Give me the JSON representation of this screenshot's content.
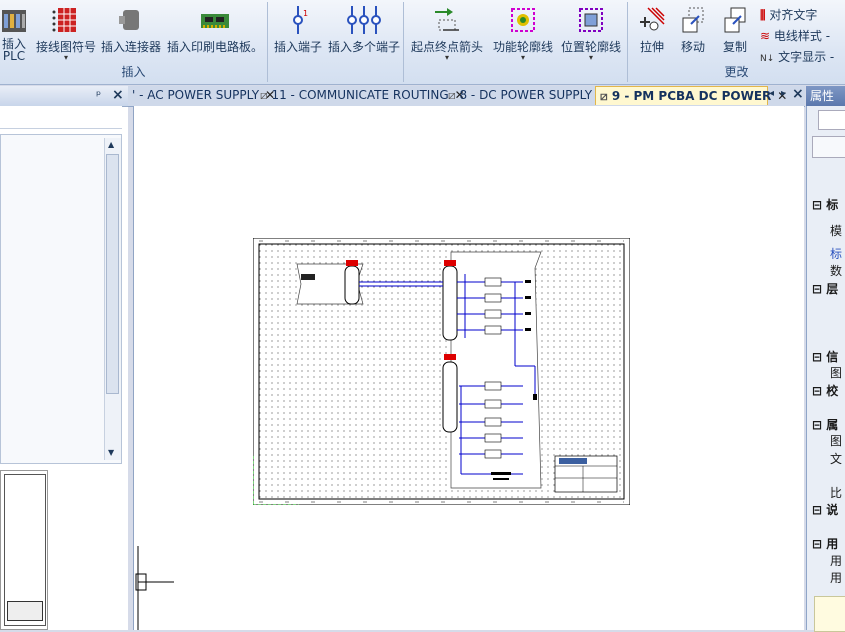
{
  "ribbon": {
    "insert_group": {
      "label": "插入",
      "buttons": [
        {
          "label": "插入 PLC"
        },
        {
          "label": "接线图符号"
        },
        {
          "label": "插入连接器"
        },
        {
          "label": "插入印刷电路板。"
        },
        {
          "label": "插入端子"
        },
        {
          "label": "插入多个端子"
        },
        {
          "label": "起点终点箭头"
        },
        {
          "label": "功能轮廓线"
        },
        {
          "label": "位置轮廓线"
        }
      ]
    },
    "modify_group": {
      "label": "更改",
      "buttons": [
        {
          "label": "拉伸"
        },
        {
          "label": "移动"
        },
        {
          "label": "复制"
        }
      ],
      "small": [
        {
          "label": "对齐文字"
        },
        {
          "label": "电线样式 -"
        },
        {
          "label": "文字显示 -"
        }
      ]
    }
  },
  "left_panel": {
    "pin": "ᵖ",
    "close": "×"
  },
  "tabs": [
    {
      "label": "' - AC POWER SUPPLY",
      "active": false
    },
    {
      "label": "11 - COMMUNICATE ROUTING",
      "active": false
    },
    {
      "label": "8 - DC POWER SUPPLY",
      "active": false
    },
    {
      "label": "9 - PM PCBA DC POWER",
      "active": true
    }
  ],
  "tab_nav": {
    "prev": "◂",
    "next": "▸",
    "close": "×"
  },
  "right_panel": {
    "title": "属性",
    "rows": [
      "标",
      "模",
      "标",
      "数",
      "层",
      "信",
      "图",
      "校",
      "属",
      "图",
      "文",
      "比",
      "说",
      "用",
      "用",
      "用"
    ]
  },
  "colors": {
    "accent": "#3b5fa0",
    "wire": "#0000cc",
    "marker": "#dd0000"
  }
}
